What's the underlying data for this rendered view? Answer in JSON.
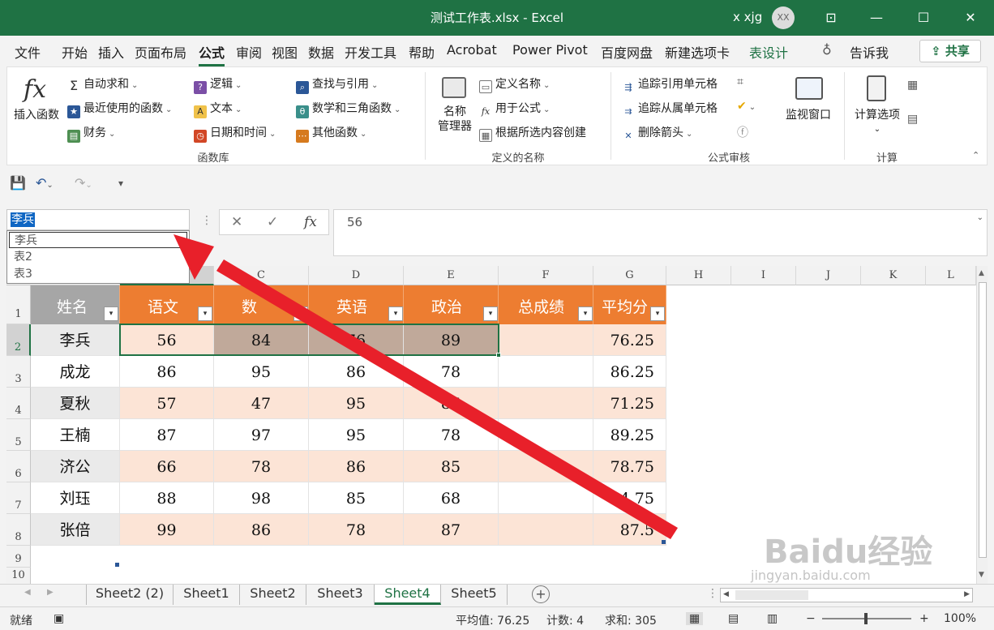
{
  "titlebar": {
    "title": "测试工作表.xlsx  -  Excel",
    "user": "x xjg",
    "avatar": "XX"
  },
  "menu": {
    "tabs": [
      "文件",
      "开始",
      "插入",
      "页面布局",
      "公式",
      "审阅",
      "视图",
      "数据",
      "开发工具",
      "帮助",
      "Acrobat",
      "Power Pivot",
      "百度网盘",
      "新建选项卡",
      "表设计"
    ],
    "tell_me": "告诉我",
    "share": "共享"
  },
  "ribbon": {
    "insert_function": "插入函数",
    "func_lib": {
      "autosum": "自动求和",
      "recent": "最近使用的函数",
      "finance": "财务",
      "logic": "逻辑",
      "text": "文本",
      "datetime": "日期和时间",
      "lookup": "查找与引用",
      "math": "数学和三角函数",
      "other": "其他函数",
      "label": "函数库"
    },
    "names": {
      "manager_line1": "名称",
      "manager_line2": "管理器",
      "define": "定义名称",
      "use": "用于公式",
      "create": "根据所选内容创建",
      "label": "定义的名称"
    },
    "audit": {
      "trace_prec": "追踪引用单元格",
      "trace_dep": "追踪从属单元格",
      "remove": "删除箭头",
      "watch": "监视窗口",
      "label": "公式审核"
    },
    "calc": {
      "options": "计算选项",
      "label": "计算"
    }
  },
  "namebox": {
    "value": "李兵",
    "options": [
      "李兵",
      "表2",
      "表3"
    ]
  },
  "formula": {
    "value": "56"
  },
  "columns": [
    "C",
    "D",
    "E",
    "F",
    "G",
    "H",
    "I",
    "J",
    "K",
    "L"
  ],
  "rows": [
    "1",
    "2",
    "3",
    "4",
    "5",
    "6",
    "7",
    "8",
    "9",
    "10"
  ],
  "table": {
    "headers": [
      "姓名",
      "语文",
      "数学",
      "英语",
      "政治",
      "总成绩",
      "平均分"
    ],
    "header_visible": [
      "姓名",
      "语文",
      "数",
      "英语",
      "政治",
      "总成绩",
      "平均分"
    ],
    "rows": [
      [
        "李兵",
        "56",
        "84",
        "76",
        "89",
        "",
        "76.25"
      ],
      [
        "成龙",
        "86",
        "95",
        "86",
        "78",
        "",
        "86.25"
      ],
      [
        "夏秋",
        "57",
        "47",
        "95",
        "86",
        "",
        "71.25"
      ],
      [
        "王楠",
        "87",
        "97",
        "95",
        "78",
        "",
        "89.25"
      ],
      [
        "济公",
        "66",
        "78",
        "86",
        "85",
        "",
        "78.75"
      ],
      [
        "刘珏",
        "88",
        "98",
        "85",
        "68",
        "",
        "84.75"
      ],
      [
        "张倍",
        "99",
        "86",
        "78",
        "87",
        "",
        "87.5"
      ]
    ]
  },
  "sheets": [
    "Sheet2 (2)",
    "Sheet1",
    "Sheet2",
    "Sheet3",
    "Sheet4",
    "Sheet5"
  ],
  "active_sheet": "Sheet4",
  "status": {
    "ready": "就绪",
    "average": "平均值: 76.25",
    "count": "计数: 4",
    "sum": "求和: 305",
    "zoom": "100%"
  },
  "colors": {
    "excel_green": "#1f7244",
    "table_header": "#ed7d31",
    "band": "#fce4d6",
    "selection": "#c0a99a",
    "arrow": "#e8202a"
  },
  "watermark": {
    "main": "Baidu经验",
    "sub": "jingyan.baidu.com"
  }
}
